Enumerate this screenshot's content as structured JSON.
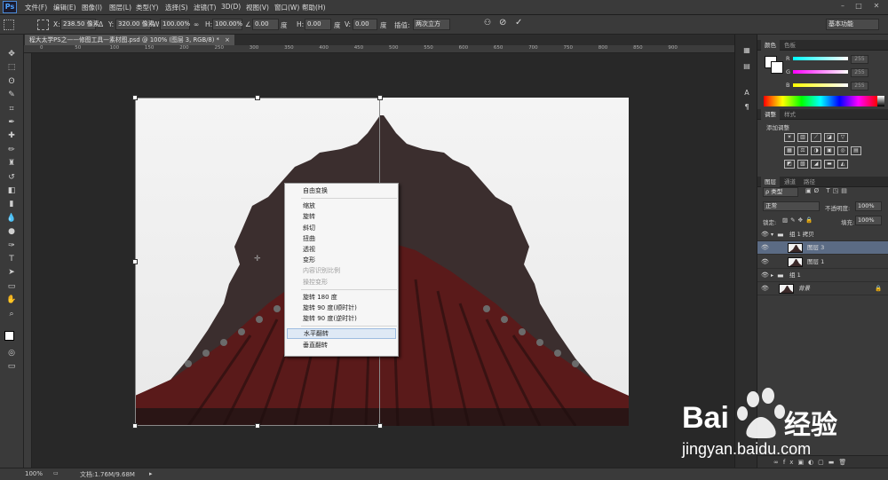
{
  "app": {
    "logo": "Ps"
  },
  "menu": [
    "文件(F)",
    "编辑(E)",
    "图像(I)",
    "图层(L)",
    "类型(Y)",
    "选择(S)",
    "滤镜(T)",
    "3D(D)",
    "视图(V)",
    "窗口(W)",
    "帮助(H)"
  ],
  "options": {
    "x_label": "X:",
    "x_value": "238.50 像素",
    "y_label": "Y:",
    "y_value": "320.00 像素",
    "w_label": "W:",
    "w_value": "100.00%",
    "h_label": "H:",
    "h_value": "100.00%",
    "angle_value": "0.00",
    "angle_unit": "度",
    "hskew_label": "H:",
    "hskew_value": "0.00",
    "hskew_unit": "度",
    "vskew_label": "V:",
    "vskew_value": "0.00",
    "vskew_unit": "度",
    "interp_label": "插值:",
    "interp_value": "两次立方",
    "workspace": "基本功能"
  },
  "document": {
    "tab_title": "程大太学PS之——修图工具—素材图.psd @ 100% (图层 3, RGB/8) *"
  },
  "ruler_top": [
    "0",
    "50",
    "100",
    "150",
    "200",
    "250",
    "300",
    "350",
    "400",
    "450",
    "500",
    "550",
    "600",
    "650",
    "700",
    "750",
    "800",
    "850",
    "900"
  ],
  "context_menu": {
    "items": [
      {
        "label": "自由变换",
        "state": "normal"
      },
      {
        "sep": true
      },
      {
        "label": "缩放",
        "state": "normal"
      },
      {
        "label": "旋转",
        "state": "normal"
      },
      {
        "label": "斜切",
        "state": "normal"
      },
      {
        "label": "扭曲",
        "state": "normal"
      },
      {
        "label": "透视",
        "state": "normal"
      },
      {
        "label": "变形",
        "state": "normal"
      },
      {
        "label": "内容识别比例",
        "state": "disabled"
      },
      {
        "label": "操控变形",
        "state": "disabled"
      },
      {
        "sep": true
      },
      {
        "label": "旋转 180 度",
        "state": "normal"
      },
      {
        "label": "旋转 90 度(顺时针)",
        "state": "normal"
      },
      {
        "label": "旋转 90 度(逆时针)",
        "state": "normal"
      },
      {
        "sep": true
      },
      {
        "label": "水平翻转",
        "state": "highlighted"
      },
      {
        "label": "垂直翻转",
        "state": "normal"
      }
    ]
  },
  "color_panel": {
    "tabs": [
      "颜色",
      "色板"
    ],
    "channels": [
      {
        "label": "R",
        "value": "255"
      },
      {
        "label": "G",
        "value": "255"
      },
      {
        "label": "B",
        "value": "255"
      }
    ]
  },
  "adjustments_panel": {
    "tabs": [
      "调整",
      "样式"
    ],
    "title": "添加调整"
  },
  "layers_panel": {
    "tabs": [
      "图层",
      "通道",
      "路径"
    ],
    "filter": "类型",
    "blend_mode": "正常",
    "opacity_label": "不透明度:",
    "opacity_value": "100%",
    "lock_label": "锁定:",
    "fill_label": "填充:",
    "fill_value": "100%",
    "layers": [
      {
        "name": "组 1 拷贝",
        "kind": "group",
        "selected": false
      },
      {
        "name": "图层 3",
        "kind": "layer",
        "selected": true
      },
      {
        "name": "图层 1",
        "kind": "layer",
        "selected": false
      },
      {
        "name": "组 1",
        "kind": "group",
        "selected": false
      },
      {
        "name": "背景",
        "kind": "background",
        "selected": false
      }
    ]
  },
  "status": {
    "zoom": "100%",
    "doc_size": "文档:1.76M/9.68M"
  },
  "watermark": {
    "brand": "Bai",
    "brand_cn": "经验",
    "url": "jingyan.baidu.com"
  }
}
